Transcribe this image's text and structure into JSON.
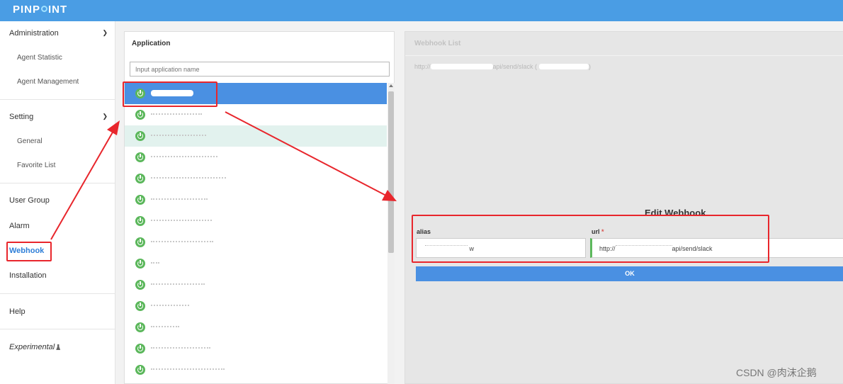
{
  "header": {
    "logo_before": "PINP",
    "logo_after": "INT"
  },
  "sidebar": {
    "administration": "Administration",
    "agent_statistic": "Agent Statistic",
    "agent_management": "Agent Management",
    "setting": "Setting",
    "general": "General",
    "favorite_list": "Favorite List",
    "user_group": "User Group",
    "alarm": "Alarm",
    "webhook": "Webhook",
    "installation": "Installation",
    "help": "Help",
    "experimental": "Experimental"
  },
  "application": {
    "title": "Application",
    "search_placeholder": "Input application name",
    "rows": [
      {
        "state": "selected",
        "mask": 60
      },
      {
        "state": "normal",
        "mask": 72
      },
      {
        "state": "hover",
        "mask": 78
      },
      {
        "state": "normal",
        "mask": 94
      },
      {
        "state": "normal",
        "mask": 106
      },
      {
        "state": "normal",
        "mask": 80
      },
      {
        "state": "normal",
        "mask": 86
      },
      {
        "state": "normal",
        "mask": 88
      },
      {
        "state": "normal",
        "mask": 12
      },
      {
        "state": "normal",
        "mask": 76
      },
      {
        "state": "normal",
        "mask": 54
      },
      {
        "state": "normal",
        "mask": 40
      },
      {
        "state": "normal",
        "mask": 84
      },
      {
        "state": "normal",
        "mask": 104
      },
      {
        "state": "normal",
        "mask": 30
      }
    ]
  },
  "webhook_list": {
    "title": "Webhook List",
    "url_prefix": "http://",
    "url_path": "api/send/slack (",
    "url_suffix": ")"
  },
  "edit_webhook": {
    "title": "Edit Webhook",
    "alias_label": "alias",
    "alias_value_visible": "w",
    "url_label": "url",
    "required_mark": "*",
    "url_prefix": "http://",
    "url_suffix": "api/send/slack",
    "ok_label": "OK"
  },
  "watermark": "CSDN @肉沫企鹅",
  "colors": {
    "header": "#4a9de4",
    "primary": "#4a90e2",
    "annotation_red": "#e8262c",
    "agent_icon": "#5bb75b"
  }
}
